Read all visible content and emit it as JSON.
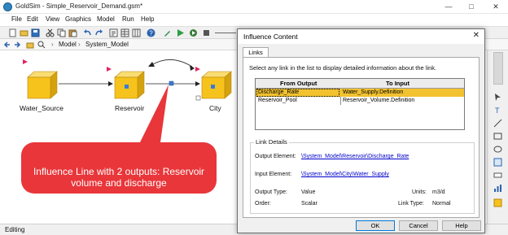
{
  "window": {
    "title": "GoldSim - Simple_Reservoir_Demand.gsm*"
  },
  "menu": [
    "File",
    "Edit",
    "View",
    "Graphics",
    "Model",
    "Run",
    "Help"
  ],
  "breadcrumb": {
    "root": "Model",
    "separator": "›",
    "current": "System_Model"
  },
  "nodes": [
    {
      "label": "Water_Source"
    },
    {
      "label": "Reservoir"
    },
    {
      "label": "City"
    }
  ],
  "callout": {
    "text": "Influence Line with 2 outputs: Reservoir volume and discharge",
    "color": "#e8363a"
  },
  "status": {
    "mode": "Editing"
  },
  "dialog": {
    "title": "Influence Content",
    "tab": "Links",
    "instruction": "Select any link in the list to display detailed information about the link.",
    "table": {
      "headers": [
        "From Output",
        "To Input"
      ],
      "rows": [
        {
          "from": "Discharge_Rate",
          "to": "Water_Supply.Definition",
          "selected": true
        },
        {
          "from": "Reservoir_Pool",
          "to": "Reservoir_Volume.Definition",
          "selected": false
        }
      ]
    },
    "details": {
      "group_title": "Link Details",
      "output_element_label": "Output Element:",
      "output_element_value": "\\System_Model\\Reservoir\\Discharge_Rate",
      "input_element_label": "Input Element:",
      "input_element_value": "\\System_Model\\City\\Water_Supply",
      "output_type_label": "Output Type:",
      "output_type_value": "Value",
      "units_label": "Units:",
      "units_value": "m3/d",
      "order_label": "Order:",
      "order_value": "Scalar",
      "link_type_label": "Link Type:",
      "link_type_value": "Normal"
    },
    "buttons": {
      "ok": "OK",
      "cancel": "Cancel",
      "help": "Help"
    }
  },
  "colors": {
    "node_fill": "#f6c21c",
    "node_port": "#3a7bd5",
    "selected_row": "#f2c230",
    "link": "#0000cc"
  }
}
